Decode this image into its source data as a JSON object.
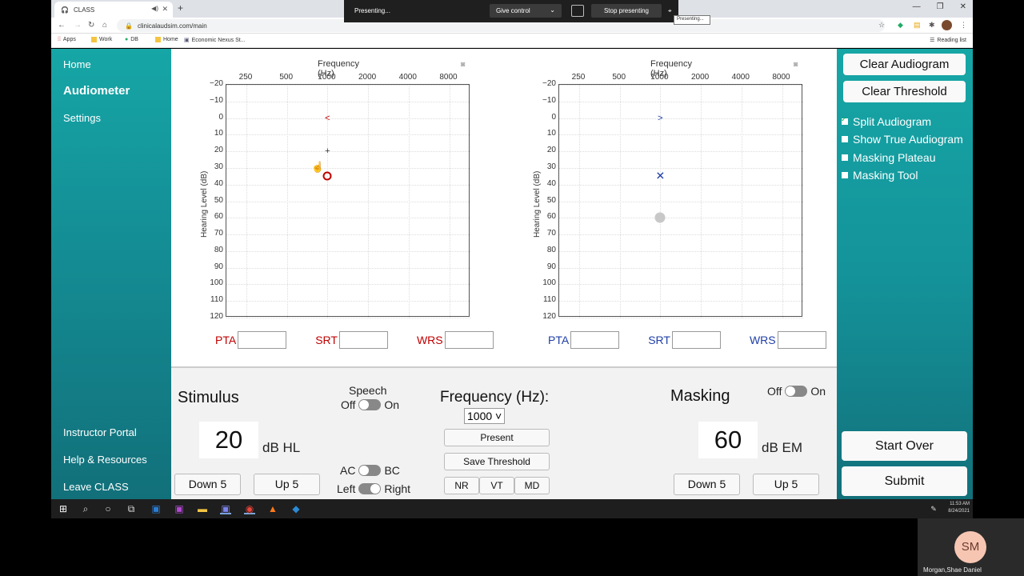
{
  "browser": {
    "tab_title": "CLASS",
    "url": "clinicalaudsim.com/main",
    "bookmarks": [
      "Apps",
      "Work",
      "DB",
      "Home",
      "Economic Nexus St..."
    ],
    "reading_list": "Reading list"
  },
  "presenting_bar": {
    "status": "Presenting...",
    "give_control": "Give control",
    "stop": "Stop presenting",
    "tooltip": "Presenting..."
  },
  "sidebar": {
    "items": [
      {
        "label": "Home"
      },
      {
        "label": "Audiometer"
      },
      {
        "label": "Settings"
      },
      {
        "label": "Instructor Portal"
      },
      {
        "label": "Help & Resources"
      },
      {
        "label": "Leave CLASS"
      }
    ]
  },
  "charts": {
    "freq_title": "Frequency (Hz)",
    "ylabel": "Hearing Level (dB)",
    "x_ticks": [
      "250",
      "500",
      "1000",
      "2000",
      "4000",
      "8000"
    ],
    "y_ticks": [
      "−20",
      "−10",
      "0",
      "10",
      "20",
      "30",
      "40",
      "50",
      "60",
      "70",
      "80",
      "90",
      "100",
      "110",
      "120"
    ]
  },
  "chart_data": [
    {
      "type": "scatter",
      "xlabel": "Frequency (Hz)",
      "ylabel": "Hearing Level (dB)",
      "ylim": [
        -20,
        120
      ],
      "x_ticks": [
        250,
        500,
        1000,
        2000,
        4000,
        8000
      ],
      "points": [
        {
          "symbol": "<",
          "x": 1000,
          "y": 0,
          "color": "#c00000"
        },
        {
          "symbol": "+",
          "x": 1000,
          "y": 20,
          "color": "#333333"
        },
        {
          "symbol": "O",
          "x": 1000,
          "y": 35,
          "color": "#c00000"
        }
      ]
    },
    {
      "type": "scatter",
      "xlabel": "Frequency (Hz)",
      "ylabel": "Hearing Level (dB)",
      "ylim": [
        -20,
        120
      ],
      "x_ticks": [
        250,
        500,
        1000,
        2000,
        4000,
        8000
      ],
      "points": [
        {
          "symbol": ">",
          "x": 1000,
          "y": 0,
          "color": "#1f3fa8"
        },
        {
          "symbol": "X",
          "x": 1000,
          "y": 35,
          "color": "#1f3fa8"
        },
        {
          "symbol": "●",
          "x": 1000,
          "y": 60,
          "color": "#c8c8c8"
        }
      ]
    }
  ],
  "measures": {
    "pta": "PTA",
    "srt": "SRT",
    "wrs": "WRS"
  },
  "colors": {
    "left_ear": "#c00000",
    "right_ear": "#1f3fa8",
    "teal": "#16a6a6"
  },
  "stimulus": {
    "title": "Stimulus",
    "value": "20",
    "unit": "dB HL",
    "down": "Down 5",
    "up": "Up 5"
  },
  "speech": {
    "label": "Speech",
    "off": "Off",
    "on": "On"
  },
  "transducer": {
    "ac": "AC",
    "bc": "BC",
    "left": "Left",
    "right": "Right"
  },
  "frequency": {
    "title": "Frequency (Hz):",
    "selected": "1000",
    "present": "Present",
    "save": "Save Threshold",
    "nr": "NR",
    "vt": "VT",
    "md": "MD"
  },
  "masking": {
    "title": "Masking",
    "off": "Off",
    "on": "On",
    "value": "60",
    "unit": "dB EM",
    "down": "Down 5",
    "up": "Up 5"
  },
  "right_panel": {
    "clear_audiogram": "Clear Audiogram",
    "clear_threshold": "Clear Threshold",
    "options": [
      {
        "label": "Split Audiogram",
        "checked": true
      },
      {
        "label": "Show True Audiogram",
        "checked": false
      },
      {
        "label": "Masking Plateau",
        "checked": false
      },
      {
        "label": "Masking Tool",
        "checked": false
      }
    ],
    "start_over": "Start Over",
    "submit": "Submit"
  },
  "taskbar": {
    "time": "11:53 AM",
    "date": "8/24/2021"
  },
  "video": {
    "initials": "SM",
    "name": "Morgan,Shae Daniel"
  }
}
